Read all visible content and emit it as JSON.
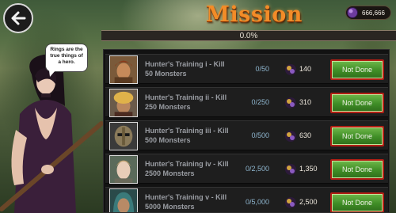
{
  "header": {
    "title": "Mission",
    "currency": {
      "icon": "gem-icon",
      "value": "666,666"
    },
    "progress": {
      "text": "0.0%",
      "fraction": 0.0
    }
  },
  "npc": {
    "speech": "Rings are the true things of a hero."
  },
  "missions": [
    {
      "name": "Hunter's Training i - Kill 50 Monsters",
      "progress": "0/50",
      "reward": "140",
      "status": "Not Done",
      "portrait": "warrior-portrait"
    },
    {
      "name": "Hunter's Training ii - Kill 250 Monsters",
      "progress": "0/250",
      "reward": "310",
      "status": "Not Done",
      "portrait": "turban-portrait"
    },
    {
      "name": "Hunter's Training iii - Kill 500 Monsters",
      "progress": "0/500",
      "reward": "630",
      "status": "Not Done",
      "portrait": "helmet-portrait"
    },
    {
      "name": "Hunter's Training iv - Kill 2500 Monsters",
      "progress": "0/2,500",
      "reward": "1,350",
      "status": "Not Done",
      "portrait": "elf-portrait"
    },
    {
      "name": "Hunter's Training v - Kill 5000 Monsters",
      "progress": "0/5,000",
      "reward": "2,500",
      "status": "Not Done",
      "portrait": "hooded-portrait"
    }
  ],
  "colors": {
    "title": "#f28c28",
    "button_fill": "#3f8d26",
    "button_border": "#b11e14",
    "progress_text": "#8fb6cf"
  }
}
